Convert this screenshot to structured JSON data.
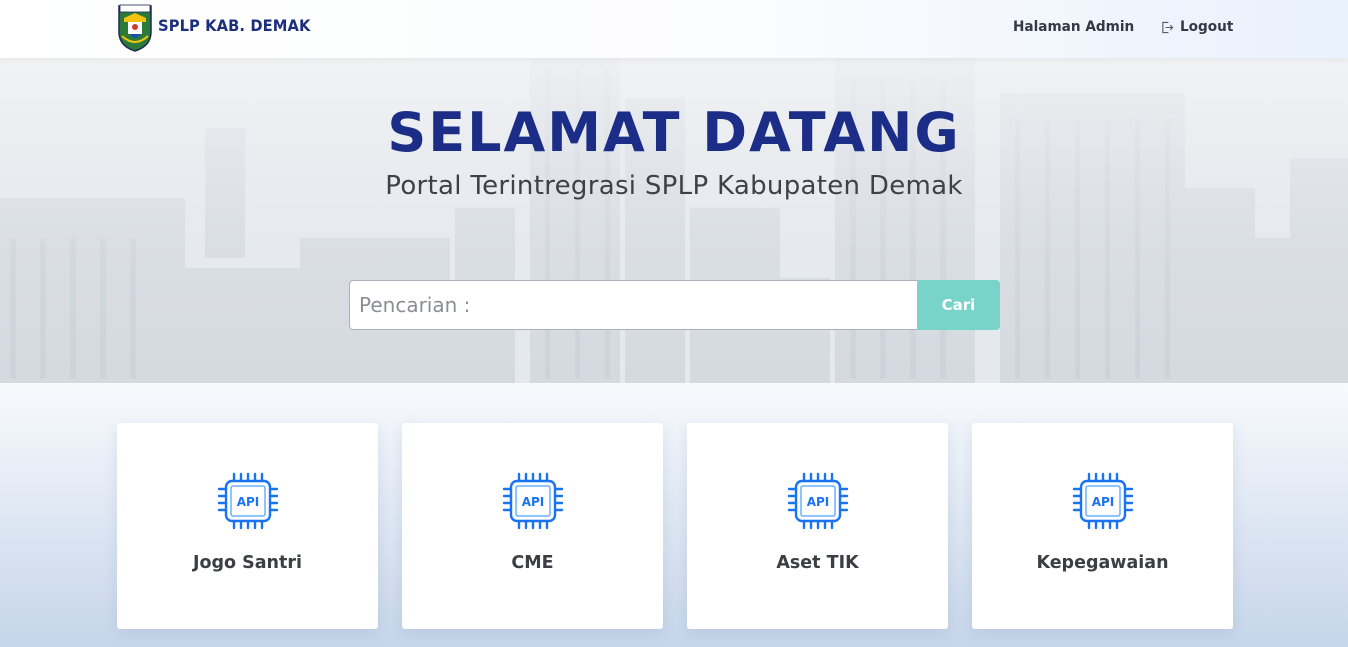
{
  "header": {
    "brand_text": "SPLP KAB. DEMAK",
    "logo_text": "DEMAK",
    "nav_admin": "Halaman Admin",
    "nav_logout": "Logout"
  },
  "hero": {
    "title": "SELAMAT DATANG",
    "subtitle": "Portal Terintregrasi SPLP Kabupaten Demak",
    "search": {
      "placeholder": "Pencarian :",
      "value": "",
      "button_label": "Cari"
    }
  },
  "cards": [
    {
      "label": "Jogo Santri",
      "icon": "api-chip-icon",
      "icon_text": "API"
    },
    {
      "label": "CME",
      "icon": "api-chip-icon",
      "icon_text": "API"
    },
    {
      "label": "Aset TIK",
      "icon": "api-chip-icon",
      "icon_text": "API"
    },
    {
      "label": "Kepegawaian",
      "icon": "api-chip-icon",
      "icon_text": "API"
    }
  ],
  "colors": {
    "brand": "#1c2f7d",
    "title": "#1b2d86",
    "accent_button": "#78d4c8",
    "icon_blue": "#1a73f0"
  }
}
